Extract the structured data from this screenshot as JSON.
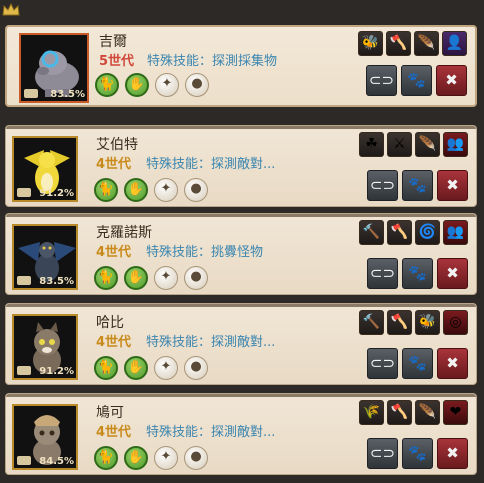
{
  "colors": {
    "accent_gold": "#c88a1a",
    "selected_gen": "#d0483a",
    "skill_text": "#3c86b0"
  },
  "pets": [
    {
      "name": "吉爾",
      "generation": "5世代",
      "skill": "特殊技能：探測採集物",
      "percent": "83.5%",
      "selected": true,
      "traits": [
        "bee-icon",
        "axe-icon",
        "wing-icon",
        "tree-icon"
      ],
      "portrait": "hippo-pet"
    },
    {
      "name": "艾伯特",
      "generation": "4世代",
      "skill": "特殊技能：探測敵對...",
      "percent": "91.2%",
      "selected": false,
      "traits": [
        "clover-icon",
        "sword-icon",
        "wing-icon",
        "tree-icon"
      ],
      "portrait": "yellow-dragon"
    },
    {
      "name": "克羅諾斯",
      "generation": "4世代",
      "skill": "特殊技能：挑釁怪物",
      "percent": "83.5%",
      "selected": false,
      "traits": [
        "hammer-icon",
        "axe-icon",
        "swirl-icon",
        "tree-icon"
      ],
      "portrait": "black-dragon"
    },
    {
      "name": "哈比",
      "generation": "4世代",
      "skill": "特殊技能：探測敵對...",
      "percent": "91.2%",
      "selected": false,
      "traits": [
        "hammer-icon",
        "axe-icon",
        "bee-icon",
        "target-icon"
      ],
      "portrait": "cat"
    },
    {
      "name": "鳩可",
      "generation": "4世代",
      "skill": "特殊技能：探測敵對...",
      "percent": "84.5%",
      "selected": false,
      "traits": [
        "grain-icon",
        "axe-icon",
        "wing-icon",
        "heart-icon"
      ],
      "portrait": "cat-tan"
    }
  ]
}
